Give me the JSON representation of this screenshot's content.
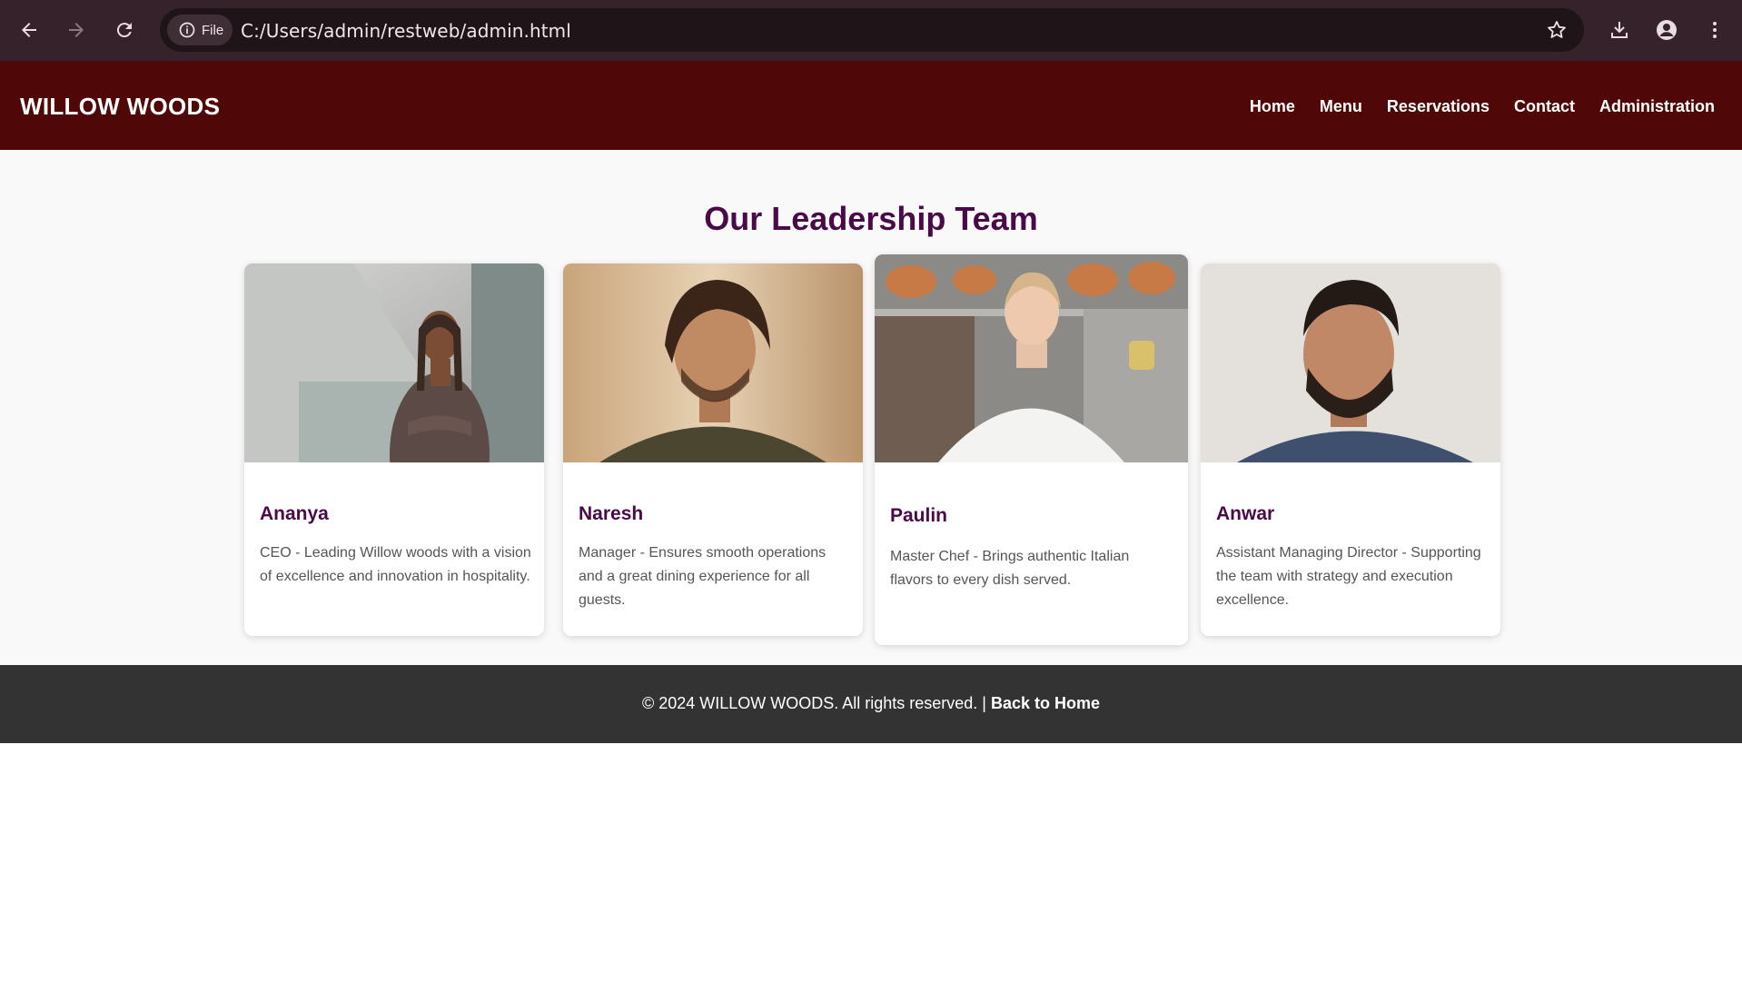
{
  "browser": {
    "url": "C:/Users/admin/restweb/admin.html",
    "site_info_label": "File",
    "icons": [
      "back-arrow-icon",
      "forward-arrow-icon",
      "reload-icon",
      "info-icon",
      "star-icon",
      "download-icon",
      "profile-icon",
      "more-vertical-icon"
    ]
  },
  "header": {
    "brand": "WILLOW WOODS",
    "nav": [
      "Home",
      "Menu",
      "Reservations",
      "Contact",
      "Administration"
    ],
    "background": "#4f0708"
  },
  "main": {
    "title": "Our Leadership Team",
    "title_color": "#4a0a48",
    "team": [
      {
        "name": "Ananya",
        "description": "CEO - Leading Willow woods with a vision of excellence and innovation in hospitality.",
        "photo": "woman-in-brown-blazer-photo"
      },
      {
        "name": "Naresh",
        "description": "Manager - Ensures smooth operations and a great dining experience for all guests.",
        "photo": "man-with-curly-hair-photo"
      },
      {
        "name": "Paulin",
        "description": "Master Chef - Brings authentic Italian flavors to every dish served.",
        "photo": "chef-in-kitchen-photo"
      },
      {
        "name": "Anwar",
        "description": "Assistant Managing Director - Supporting the team with strategy and execution excellence.",
        "photo": "bearded-man-photo"
      }
    ]
  },
  "footer": {
    "copyright": "© 2024 WILLOW WOODS. All rights reserved. |",
    "link": "Back to Home",
    "background": "#333333"
  }
}
